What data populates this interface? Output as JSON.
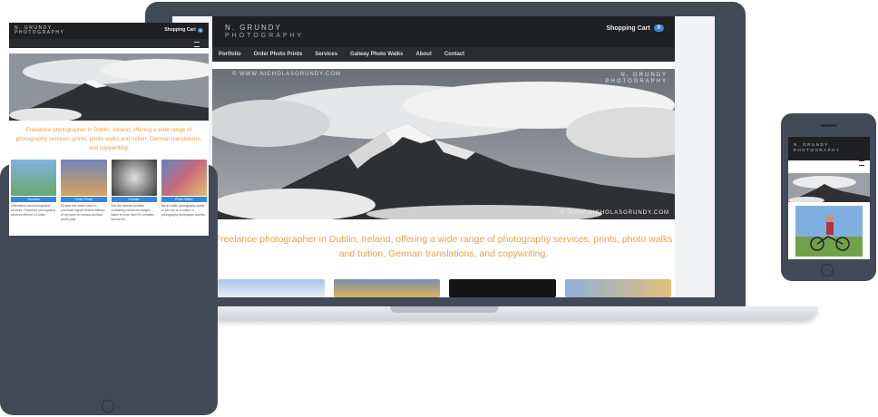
{
  "site": {
    "brand_line1": "N.   GRUNDY",
    "brand_line2": "PHOTOGRAPHY",
    "cart_label": "Shopping Cart",
    "cart_count": "0",
    "nav": [
      "Portfolio",
      "Order Photo Prints",
      "Services",
      "Galway Photo Walks",
      "About",
      "Contact"
    ],
    "hero_url": "© WWW.NICHOLASGRUNDY.COM",
    "hero_watermark_1": "N.   GRUNDY",
    "hero_watermark_2": "PHOTOGRAPHY",
    "hero_copyright": "© WWW.NICHOLASGRUNDY.COM",
    "tagline": "Freelance photographer in Dublin, Ireland, offering a wide range of photography services, prints, photo walks and tuition, German translations, and copywriting."
  },
  "tablet": {
    "cards": [
      {
        "label": "Services",
        "text": "Information and photographic services. Freelance photography services offered in Dublin.",
        "color": "#6aa86a"
      },
      {
        "label": "Order Prints",
        "text": "Browse the online store to purchase signed limited editions of my work on various archival photo print",
        "color": "#d9a35a"
      },
      {
        "label": "Portfolio",
        "text": "See the diverse portfolio containing numerous images taken in more than 90 countries across the",
        "color": "#b8b8b8"
      },
      {
        "label": "Photo Walks",
        "text": "Book Dublin photography walks, or join me on a tuition in photography techniques and the",
        "color": "#c86a7a"
      }
    ]
  },
  "colors": {
    "device_frame": "#434a57",
    "header_bg": "#1f2022",
    "accent_orange": "#f0a04b",
    "accent_blue": "#3a86d0"
  }
}
